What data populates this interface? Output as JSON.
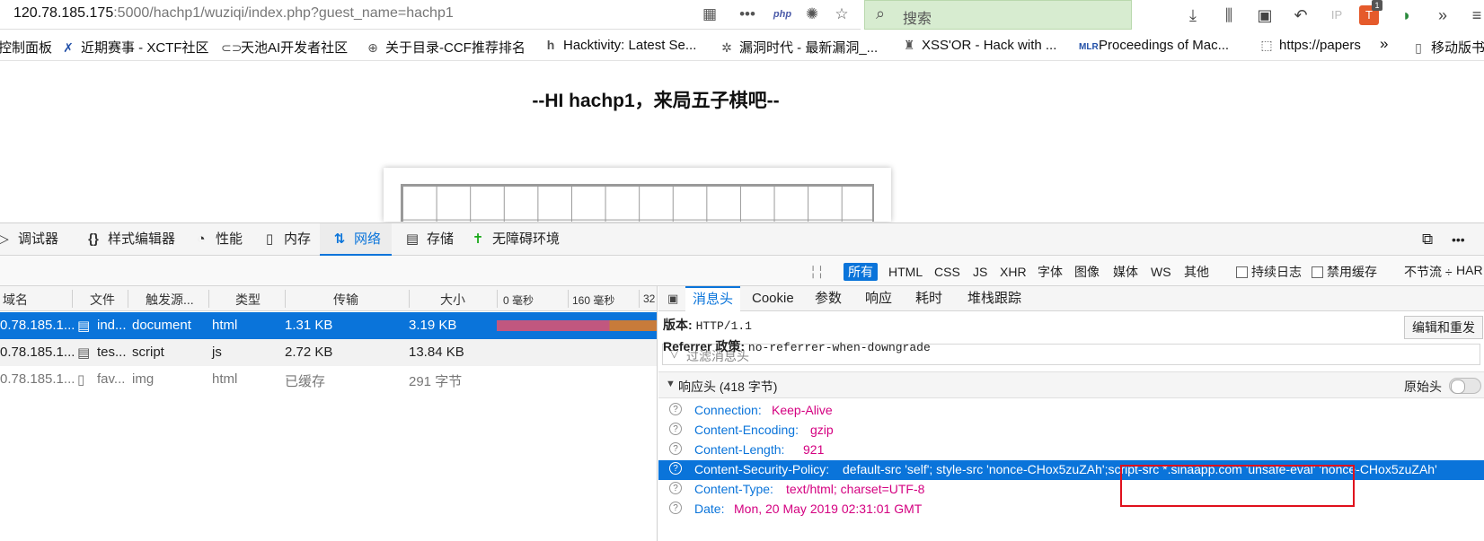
{
  "browser": {
    "url_host": "120.78.185.175",
    "url_rest": ":5000/hachp1/wuziqi/index.php?guest_name=hachp1",
    "search_placeholder": "搜索",
    "php_label": "php",
    "ip_label": "IP",
    "badge_count": "1",
    "bookmarks": [
      {
        "label": "控制面板",
        "icon": "panel-icon"
      },
      {
        "label": "近期赛事 - XCTF社区",
        "icon": "xctf-icon"
      },
      {
        "label": "天池AI开发者社区",
        "icon": "tianchi-icon"
      },
      {
        "label": "关于目录-CCF推荐排名",
        "icon": "globe-icon"
      },
      {
        "label": "Hacktivity: Latest Se...",
        "icon": "hackerone-icon"
      },
      {
        "label": "漏洞时代 - 最新漏洞_...",
        "icon": "bug-icon"
      },
      {
        "label": "XSS'OR - Hack with ...",
        "icon": "xssor-icon"
      },
      {
        "label": "Proceedings of Mac...",
        "icon": "mlr-icon"
      },
      {
        "label": "https://papers",
        "icon": "page-icon"
      },
      {
        "label": "移动版书签",
        "icon": "mobile-icon"
      }
    ]
  },
  "page": {
    "heading": "--HI hachp1，来局五子棋吧--"
  },
  "devtools": {
    "tabs": [
      {
        "label": "调试器",
        "icon": "debugger-icon"
      },
      {
        "label": "样式编辑器",
        "icon": "style-editor-icon"
      },
      {
        "label": "性能",
        "icon": "performance-icon"
      },
      {
        "label": "内存",
        "icon": "memory-icon"
      },
      {
        "label": "网络",
        "icon": "network-icon",
        "active": true
      },
      {
        "label": "存储",
        "icon": "storage-icon"
      },
      {
        "label": "无障碍环境",
        "icon": "accessibility-icon"
      }
    ],
    "filter_buttons": [
      "所有",
      "HTML",
      "CSS",
      "JS",
      "XHR",
      "字体",
      "图像",
      "媒体",
      "WS",
      "其他"
    ],
    "persist_logs": "持续日志",
    "disable_cache": "禁用缓存",
    "throttle": "不节流 ÷",
    "har": "HAR",
    "columns": [
      "域名",
      "文件",
      "触发源...",
      "类型",
      "传输",
      "大小",
      "0 毫秒",
      "160 毫秒",
      "32"
    ],
    "requests": [
      {
        "domain": "0.78.185.1...",
        "file": "ind...",
        "cause": "document",
        "type": "html",
        "transferred": "1.31 KB",
        "size": "3.19 KB",
        "selected": true
      },
      {
        "domain": "0.78.185.1...",
        "file": "tes...",
        "cause": "script",
        "type": "js",
        "transferred": "2.72 KB",
        "size": "13.84 KB"
      },
      {
        "domain": "0.78.185.1...",
        "file": "fav...",
        "cause": "img",
        "type": "html",
        "transferred": "已缓存",
        "size": "291 字节"
      }
    ],
    "detail_tabs": [
      "消息头",
      "Cookie",
      "参数",
      "响应",
      "耗时",
      "堆栈跟踪"
    ],
    "version_label": "版本:",
    "version_value": "HTTP/1.1",
    "referrer_label": "Referrer 政策:",
    "referrer_value": "no-referrer-when-downgrade",
    "resend_label": "编辑和重发",
    "filter_placeholder": "过滤消息头",
    "response_headers_label": "响应头 (418 字节)",
    "raw_headers_label": "原始头",
    "headers": [
      {
        "name": "Connection:",
        "value": "Keep-Alive"
      },
      {
        "name": "Content-Encoding:",
        "value": "gzip"
      },
      {
        "name": "Content-Length:",
        "value": "921"
      },
      {
        "name": "Content-Security-Policy:",
        "value": "default-src 'self'; style-src 'nonce-CHox5zuZAh';script-src *.sinaapp.com 'unsafe-eval' 'nonce-CHox5zuZAh'",
        "selected": true
      },
      {
        "name": "Content-Type:",
        "value": "text/html; charset=UTF-8"
      },
      {
        "name": "Date:",
        "value": "Mon, 20 May 2019 02:31:01 GMT"
      }
    ]
  },
  "colors": {
    "accent": "#0a74da",
    "header_value": "#d40080",
    "annotation_box": "#e0101c",
    "search_bg": "#d7ecd0"
  }
}
